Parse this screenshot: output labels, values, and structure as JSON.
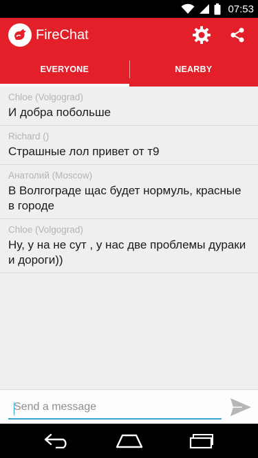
{
  "status_bar": {
    "time": "07:53",
    "icons": [
      "wifi-icon",
      "signal-icon",
      "battery-icon"
    ]
  },
  "app_bar": {
    "title": "FireChat",
    "logo_icon": "firechat-logo-icon",
    "actions": [
      "settings-gear-icon",
      "share-icon"
    ],
    "accent_color": "#e3202a"
  },
  "tabs": [
    {
      "label": "EVERYONE",
      "active": true
    },
    {
      "label": "NEARBY",
      "active": false
    }
  ],
  "messages": [
    {
      "author": "Chloe (Volgograd)",
      "text": "И добра побольше"
    },
    {
      "author": "Richard ()",
      "text": "Страшные лол привет от т9"
    },
    {
      "author": "Анатолий (Moscow)",
      "text": "В Волгограде щас будет нормуль, красные в городе"
    },
    {
      "author": "Chloe (Volgograd)",
      "text": "Ну, у на не сут , у нас две проблемы дураки и дороги))"
    }
  ],
  "composer": {
    "value": "",
    "placeholder": "Send a message",
    "send_icon": "send-icon",
    "focus_color": "#33a6d1"
  },
  "nav_bar": {
    "icons": [
      "back-icon",
      "home-icon",
      "recents-icon"
    ]
  }
}
